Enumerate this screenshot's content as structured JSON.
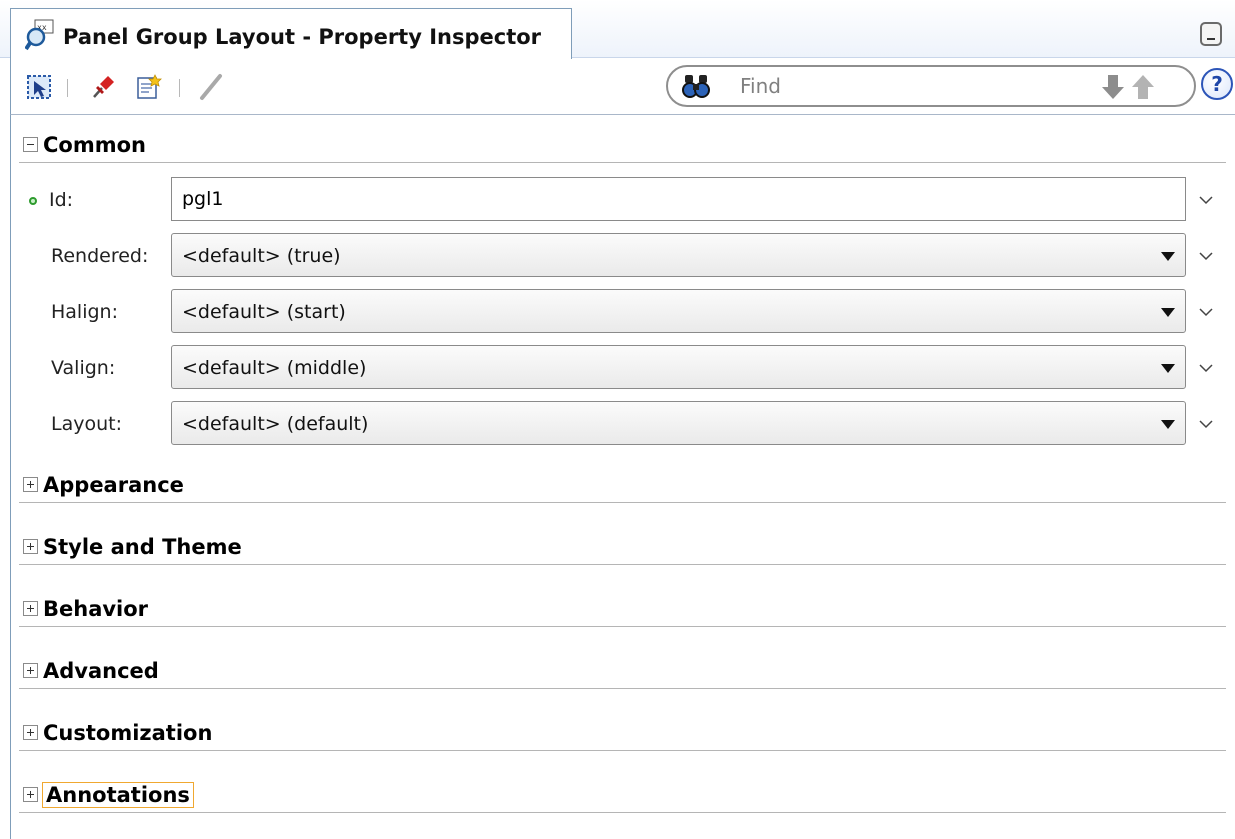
{
  "window": {
    "title": "Panel Group Layout - Property Inspector"
  },
  "toolbar": {
    "find_placeholder": "Find",
    "help_label": "?"
  },
  "sections": {
    "common": {
      "label": "Common",
      "expanded": true
    },
    "appearance": {
      "label": "Appearance",
      "expanded": false
    },
    "style_theme": {
      "label": "Style and Theme",
      "expanded": false
    },
    "behavior": {
      "label": "Behavior",
      "expanded": false
    },
    "advanced": {
      "label": "Advanced",
      "expanded": false
    },
    "customization": {
      "label": "Customization",
      "expanded": false
    },
    "annotations": {
      "label": "Annotations",
      "expanded": false
    }
  },
  "properties": {
    "id": {
      "label": "Id:",
      "value": "pgl1"
    },
    "rendered": {
      "label": "Rendered:",
      "value": "<default> (true)"
    },
    "halign": {
      "label": "Halign:",
      "value": "<default> (start)"
    },
    "valign": {
      "label": "Valign:",
      "value": "<default> (middle)"
    },
    "layout": {
      "label": "Layout:",
      "value": "<default> (default)"
    }
  },
  "colors": {
    "border": "#7f9db9",
    "required_indicator": "#2e9b2e",
    "focus_outline": "#f0a830",
    "help_blue": "#2c55b8"
  }
}
